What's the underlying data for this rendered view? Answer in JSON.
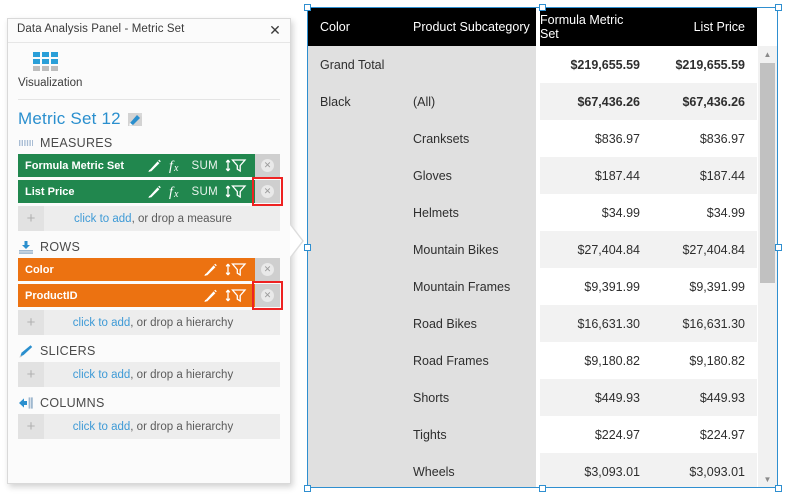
{
  "panel": {
    "title": "Data Analysis Panel - Metric Set",
    "close_label": "✕",
    "visualization_label": "Visualization",
    "metric_set_name": "Metric Set 12",
    "sections": [
      {
        "id": "measures",
        "label": "MEASURES",
        "icon": "measures-icon",
        "chips": [
          {
            "label": "Formula Metric Set",
            "color": "#21874e",
            "aggregate": "SUM",
            "tools": [
              "pencil-icon",
              "formula-icon",
              "aggregate-label",
              "sort-filter-icon"
            ],
            "remove_label": "✕",
            "highlighted": false
          },
          {
            "label": "List Price",
            "color": "#21874e",
            "aggregate": "SUM",
            "tools": [
              "pencil-icon",
              "formula-icon",
              "aggregate-label",
              "sort-filter-icon"
            ],
            "remove_label": "✕",
            "highlighted": true
          }
        ],
        "add_row": {
          "plus": "+",
          "link": "click to add",
          "rest": ", or drop a measure"
        }
      },
      {
        "id": "rows",
        "label": "ROWS",
        "icon": "rows-icon",
        "chips": [
          {
            "label": "Color",
            "color": "#ec7211",
            "aggregate": "",
            "tools": [
              "pencil-icon",
              "sort-filter-icon"
            ],
            "remove_label": "✕",
            "highlighted": false
          },
          {
            "label": "ProductID",
            "color": "#ec7211",
            "aggregate": "",
            "tools": [
              "pencil-icon",
              "sort-filter-icon"
            ],
            "remove_label": "✕",
            "highlighted": true
          }
        ],
        "add_row": {
          "plus": "+",
          "link": "click to add",
          "rest": ", or drop a hierarchy"
        }
      },
      {
        "id": "slicers",
        "label": "SLICERS",
        "icon": "slicers-icon",
        "chips": [],
        "add_row": {
          "plus": "+",
          "link": "click to add",
          "rest": ", or drop a hierarchy"
        }
      },
      {
        "id": "columns",
        "label": "COLUMNS",
        "icon": "columns-icon",
        "chips": [],
        "add_row": {
          "plus": "+",
          "link": "click to add",
          "rest": ", or drop a hierarchy"
        }
      }
    ]
  },
  "table": {
    "columns": [
      "Color",
      "Product Subcategory",
      "Formula Metric Set",
      "List Price"
    ],
    "rows": [
      {
        "color": "Grand Total",
        "subcategory": "",
        "formula": "$219,655.59",
        "list": "$219,655.59",
        "style": "total"
      },
      {
        "color": "Black",
        "subcategory": "(All)",
        "formula": "$67,436.26",
        "list": "$67,436.26",
        "style": "group"
      },
      {
        "color": "",
        "subcategory": "Cranksets",
        "formula": "$836.97",
        "list": "$836.97",
        "style": "plain"
      },
      {
        "color": "",
        "subcategory": "Gloves",
        "formula": "$187.44",
        "list": "$187.44",
        "style": "alt"
      },
      {
        "color": "",
        "subcategory": "Helmets",
        "formula": "$34.99",
        "list": "$34.99",
        "style": "plain"
      },
      {
        "color": "",
        "subcategory": "Mountain Bikes",
        "formula": "$27,404.84",
        "list": "$27,404.84",
        "style": "alt"
      },
      {
        "color": "",
        "subcategory": "Mountain Frames",
        "formula": "$9,391.99",
        "list": "$9,391.99",
        "style": "plain"
      },
      {
        "color": "",
        "subcategory": "Road Bikes",
        "formula": "$16,631.30",
        "list": "$16,631.30",
        "style": "alt"
      },
      {
        "color": "",
        "subcategory": "Road Frames",
        "formula": "$9,180.82",
        "list": "$9,180.82",
        "style": "plain"
      },
      {
        "color": "",
        "subcategory": "Shorts",
        "formula": "$449.93",
        "list": "$449.93",
        "style": "alt"
      },
      {
        "color": "",
        "subcategory": "Tights",
        "formula": "$224.97",
        "list": "$224.97",
        "style": "plain"
      },
      {
        "color": "",
        "subcategory": "Wheels",
        "formula": "$3,093.01",
        "list": "$3,093.01",
        "style": "alt"
      }
    ],
    "scroll_up": "▲",
    "scroll_down": "▼"
  },
  "colors": {
    "measure_green": "#21874e",
    "row_orange": "#ec7211",
    "accent_blue": "#2a8fce",
    "selection_blue": "#2f8fd0",
    "highlight_red": "#ee2222",
    "header_black": "#000000"
  }
}
